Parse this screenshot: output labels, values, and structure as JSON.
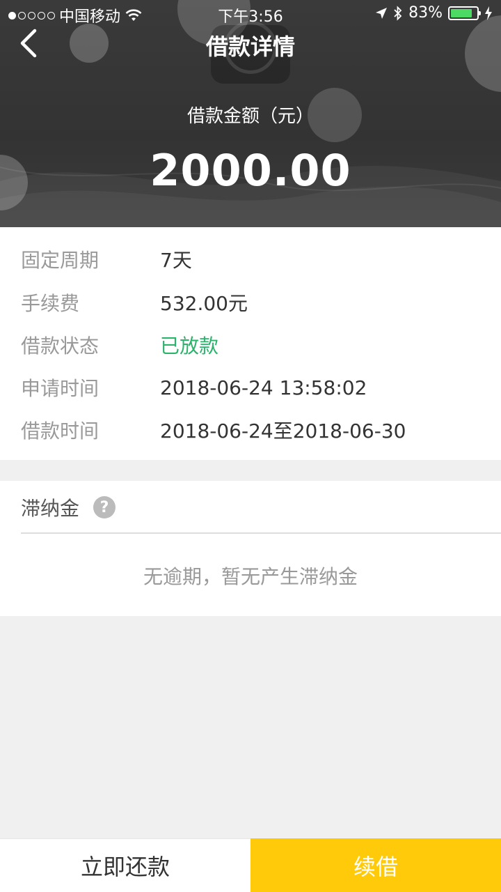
{
  "status_bar": {
    "carrier": "中国移动",
    "time": "下午3:56",
    "battery_percent": "83%",
    "battery_level": 0.83,
    "signal_filled": 1,
    "signal_total": 5
  },
  "nav": {
    "title": "借款详情"
  },
  "summary": {
    "amount_label": "借款金额（元）",
    "amount_value": "2000.00"
  },
  "details": [
    {
      "label": "固定周期",
      "value": "7天"
    },
    {
      "label": "手续费",
      "value": "532.00元"
    },
    {
      "label": "借款状态",
      "value": "已放款"
    },
    {
      "label": "申请时间",
      "value": "2018-06-24 13:58:02"
    },
    {
      "label": "借款时间",
      "value": "2018-06-24至2018-06-30"
    }
  ],
  "late_fee": {
    "title": "滞纳金",
    "help_symbol": "?",
    "empty_text": "无逾期，暂无产生滞纳金"
  },
  "actions": {
    "repay_label": "立即还款",
    "renew_label": "续借"
  },
  "colors": {
    "accent_yellow": "#ffca0a",
    "status_green": "#2bb36b",
    "header_dark": "#363636"
  }
}
